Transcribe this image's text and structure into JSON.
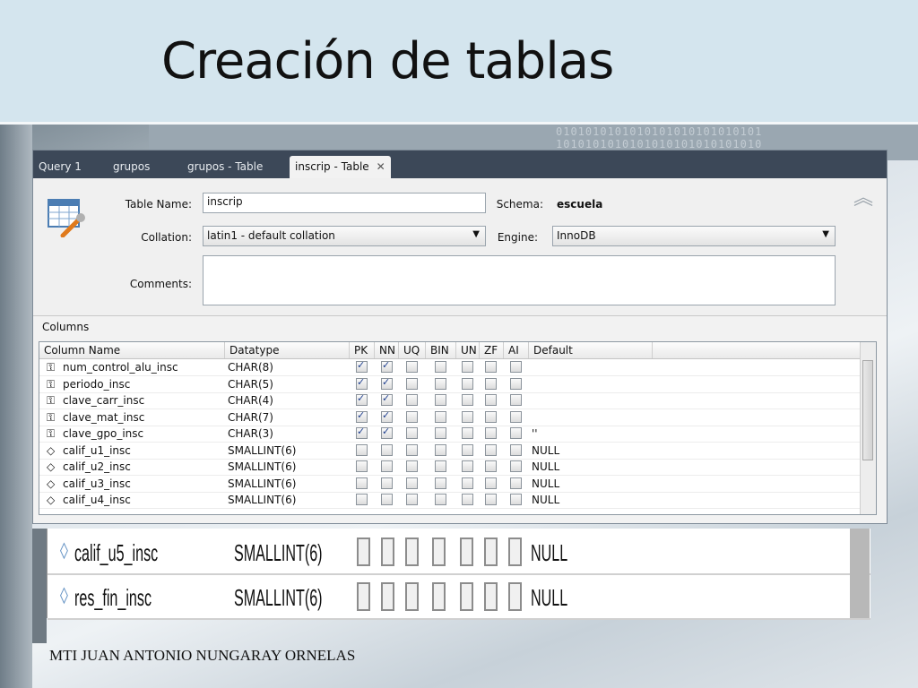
{
  "slide": {
    "title": "Creación de tablas",
    "footer": "MTI JUAN ANTONIO NUNGARAY ORNELAS",
    "binary1": "0101010101010101010101010101",
    "binary2": "1010101010101010101010101010"
  },
  "tabs": [
    {
      "label": "Query 1"
    },
    {
      "label": "grupos"
    },
    {
      "label": "grupos - Table"
    },
    {
      "label": "inscrip - Table",
      "close": "✕"
    }
  ],
  "editor": {
    "table_name_label": "Table Name:",
    "table_name_value": "inscrip",
    "schema_label": "Schema:",
    "schema_value": "escuela",
    "collation_label": "Collation:",
    "collation_value": "latin1 - default collation",
    "engine_label": "Engine:",
    "engine_value": "InnoDB",
    "comments_label": "Comments:",
    "comments_value": ""
  },
  "columns_section": {
    "title": "Columns",
    "headers": [
      "Column Name",
      "Datatype",
      "PK",
      "NN",
      "UQ",
      "BIN",
      "UN",
      "ZF",
      "AI",
      "Default"
    ],
    "rows": [
      {
        "name": "num_control_alu_insc",
        "type": "CHAR(8)",
        "pk": true,
        "nn": true,
        "default": "",
        "icon": "key-icon"
      },
      {
        "name": "periodo_insc",
        "type": "CHAR(5)",
        "pk": true,
        "nn": true,
        "default": "",
        "icon": "key-icon"
      },
      {
        "name": "clave_carr_insc",
        "type": "CHAR(4)",
        "pk": true,
        "nn": true,
        "default": "",
        "icon": "key-icon"
      },
      {
        "name": "clave_mat_insc",
        "type": "CHAR(7)",
        "pk": true,
        "nn": true,
        "default": "",
        "icon": "key-icon"
      },
      {
        "name": "clave_gpo_insc",
        "type": "CHAR(3)",
        "pk": true,
        "nn": true,
        "default": "''",
        "icon": "key-icon"
      },
      {
        "name": "calif_u1_insc",
        "type": "SMALLINT(6)",
        "pk": false,
        "nn": false,
        "default": "NULL",
        "icon": "diamond-icon"
      },
      {
        "name": "calif_u2_insc",
        "type": "SMALLINT(6)",
        "pk": false,
        "nn": false,
        "default": "NULL",
        "icon": "diamond-icon"
      },
      {
        "name": "calif_u3_insc",
        "type": "SMALLINT(6)",
        "pk": false,
        "nn": false,
        "default": "NULL",
        "icon": "diamond-icon"
      },
      {
        "name": "calif_u4_insc",
        "type": "SMALLINT(6)",
        "pk": false,
        "nn": false,
        "default": "NULL",
        "icon": "diamond-icon"
      }
    ]
  },
  "zoomed_rows": [
    {
      "name": "calif_u5_insc",
      "type": "SMALLINT(6)",
      "default": "NULL"
    },
    {
      "name": "res_fin_insc",
      "type": "SMALLINT(6)",
      "default": "NULL"
    }
  ]
}
